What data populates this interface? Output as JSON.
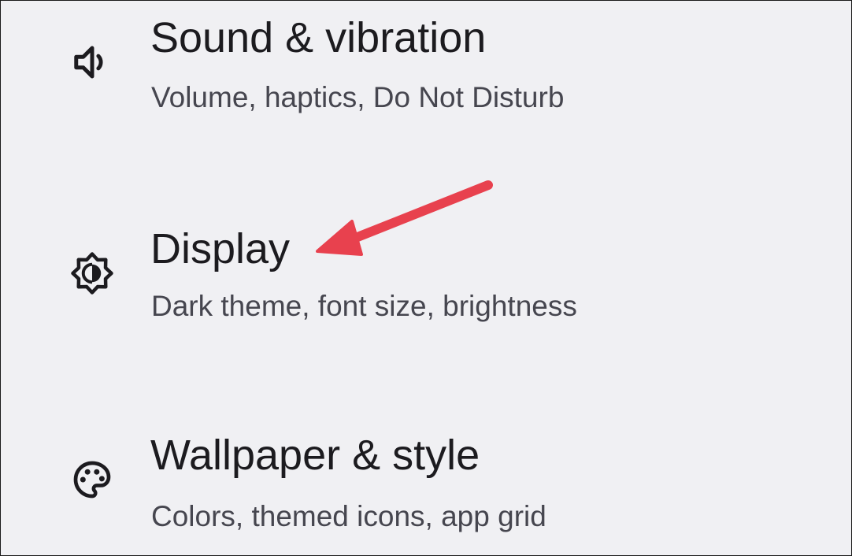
{
  "settings": {
    "items": [
      {
        "title": "Sound & vibration",
        "subtitle": "Volume, haptics, Do Not Disturb",
        "icon": "volume-icon"
      },
      {
        "title": "Display",
        "subtitle": "Dark theme, font size, brightness",
        "icon": "brightness-icon"
      },
      {
        "title": "Wallpaper & style",
        "subtitle": "Colors, themed icons, app grid",
        "icon": "palette-icon"
      }
    ]
  },
  "annotation": {
    "type": "arrow",
    "target": "Display",
    "color": "#e8414e"
  },
  "colors": {
    "background": "#f0f0f3",
    "title": "#1c1b1f",
    "subtitle": "#46464f",
    "icon": "#1c1b1f"
  }
}
